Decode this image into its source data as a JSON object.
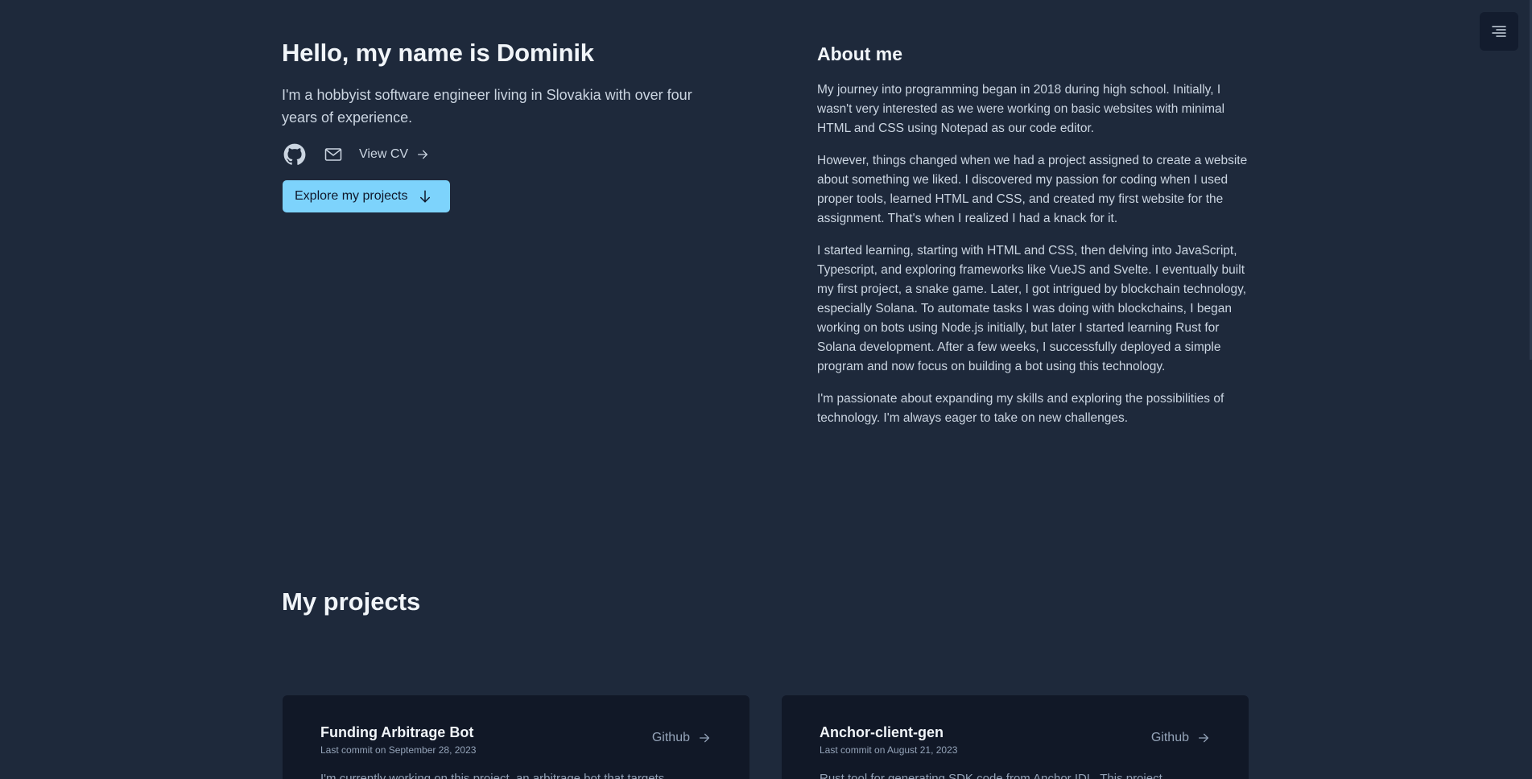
{
  "hero": {
    "title": "Hello, my name is Dominik",
    "description": "I'm a hobbyist software engineer living in Slovakia with over four years of experience.",
    "view_cv": "View CV",
    "explore_button": "Explore my projects"
  },
  "about": {
    "title": "About me",
    "paragraphs": [
      "My journey into programming began in 2018 during high school. Initially, I wasn't very interested as we were working on basic websites with minimal HTML and CSS using Notepad as our code editor.",
      "However, things changed when we had a project assigned to create a website about something we liked. I discovered my passion for coding when I used proper tools, learned HTML and CSS, and created my first website for the assignment. That's when I realized I had a knack for it.",
      "I started learning, starting with HTML and CSS, then delving into JavaScript, Typescript, and exploring frameworks like VueJS and Svelte. I eventually built my first project, a snake game. Later, I got intrigued by blockchain technology, especially Solana. To automate tasks I was doing with blockchains, I began working on bots using Node.js initially, but later I started learning Rust for Solana development. After a few weeks, I successfully deployed a simple program and now focus on building a bot using this technology.",
      "I'm passionate about expanding my skills and exploring the possibilities of technology. I'm always eager to take on new challenges."
    ]
  },
  "projects": {
    "title": "My projects",
    "items": [
      {
        "title": "Funding Arbitrage Bot",
        "date": "Last commit on September 28, 2023",
        "link": "Github",
        "description": "I'm currently working on this project, an arbitrage bot that targets..."
      },
      {
        "title": "Anchor-client-gen",
        "date": "Last commit on August 21, 2023",
        "link": "Github",
        "description": "Rust tool for generating SDK code from Anchor IDL. This project..."
      }
    ]
  }
}
